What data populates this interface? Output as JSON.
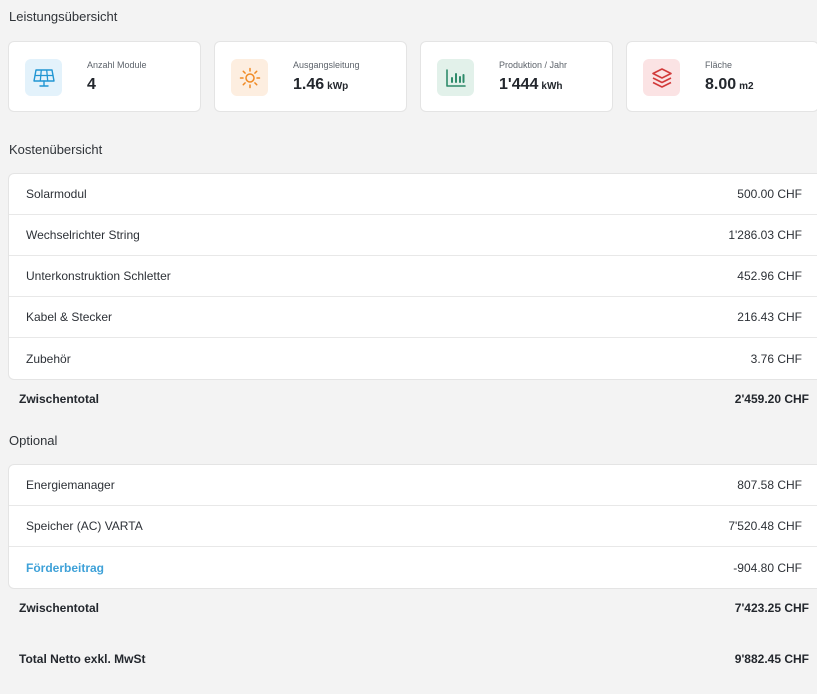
{
  "performance": {
    "title": "Leistungsübersicht",
    "cards": [
      {
        "label": "Anzahl Module",
        "value": "4",
        "unit": "",
        "icon": "solar-panel-icon",
        "color": "#2196d3",
        "bg": "#e3f2fb"
      },
      {
        "label": "Ausgangsleitung",
        "value": "1.46",
        "unit": "kWp",
        "icon": "sun-icon",
        "color": "#f08a24",
        "bg": "#fdeee0"
      },
      {
        "label": "Produktion / Jahr",
        "value": "1'444",
        "unit": "kWh",
        "icon": "bar-chart-icon",
        "color": "#2e8b6a",
        "bg": "#e2f1ea"
      },
      {
        "label": "Fläche",
        "value": "8.00",
        "unit": "m2",
        "icon": "layers-icon",
        "color": "#d23a3a",
        "bg": "#fbe3e4"
      }
    ]
  },
  "costs": {
    "title": "Kostenübersicht",
    "items": [
      {
        "name": "Solarmodul",
        "amount": "500.00 CHF"
      },
      {
        "name": "Wechselrichter String",
        "amount": "1'286.03 CHF"
      },
      {
        "name": "Unterkonstruktion Schletter",
        "amount": "452.96 CHF"
      },
      {
        "name": "Kabel & Stecker",
        "amount": "216.43 CHF"
      },
      {
        "name": "Zubehör",
        "amount": "3.76 CHF"
      }
    ],
    "subtotal_label": "Zwischentotal",
    "subtotal_amount": "2'459.20 CHF"
  },
  "optional": {
    "title": "Optional",
    "items": [
      {
        "name": "Energiemanager",
        "amount": "807.58 CHF"
      },
      {
        "name": "Speicher (AC) VARTA",
        "amount": "7'520.48 CHF"
      },
      {
        "name": "Förderbeitrag",
        "amount": "-904.80 CHF"
      }
    ],
    "subtotal_label": "Zwischentotal",
    "subtotal_amount": "7'423.25 CHF"
  },
  "total": {
    "label": "Total Netto exkl. MwSt",
    "amount": "9'882.45 CHF"
  }
}
